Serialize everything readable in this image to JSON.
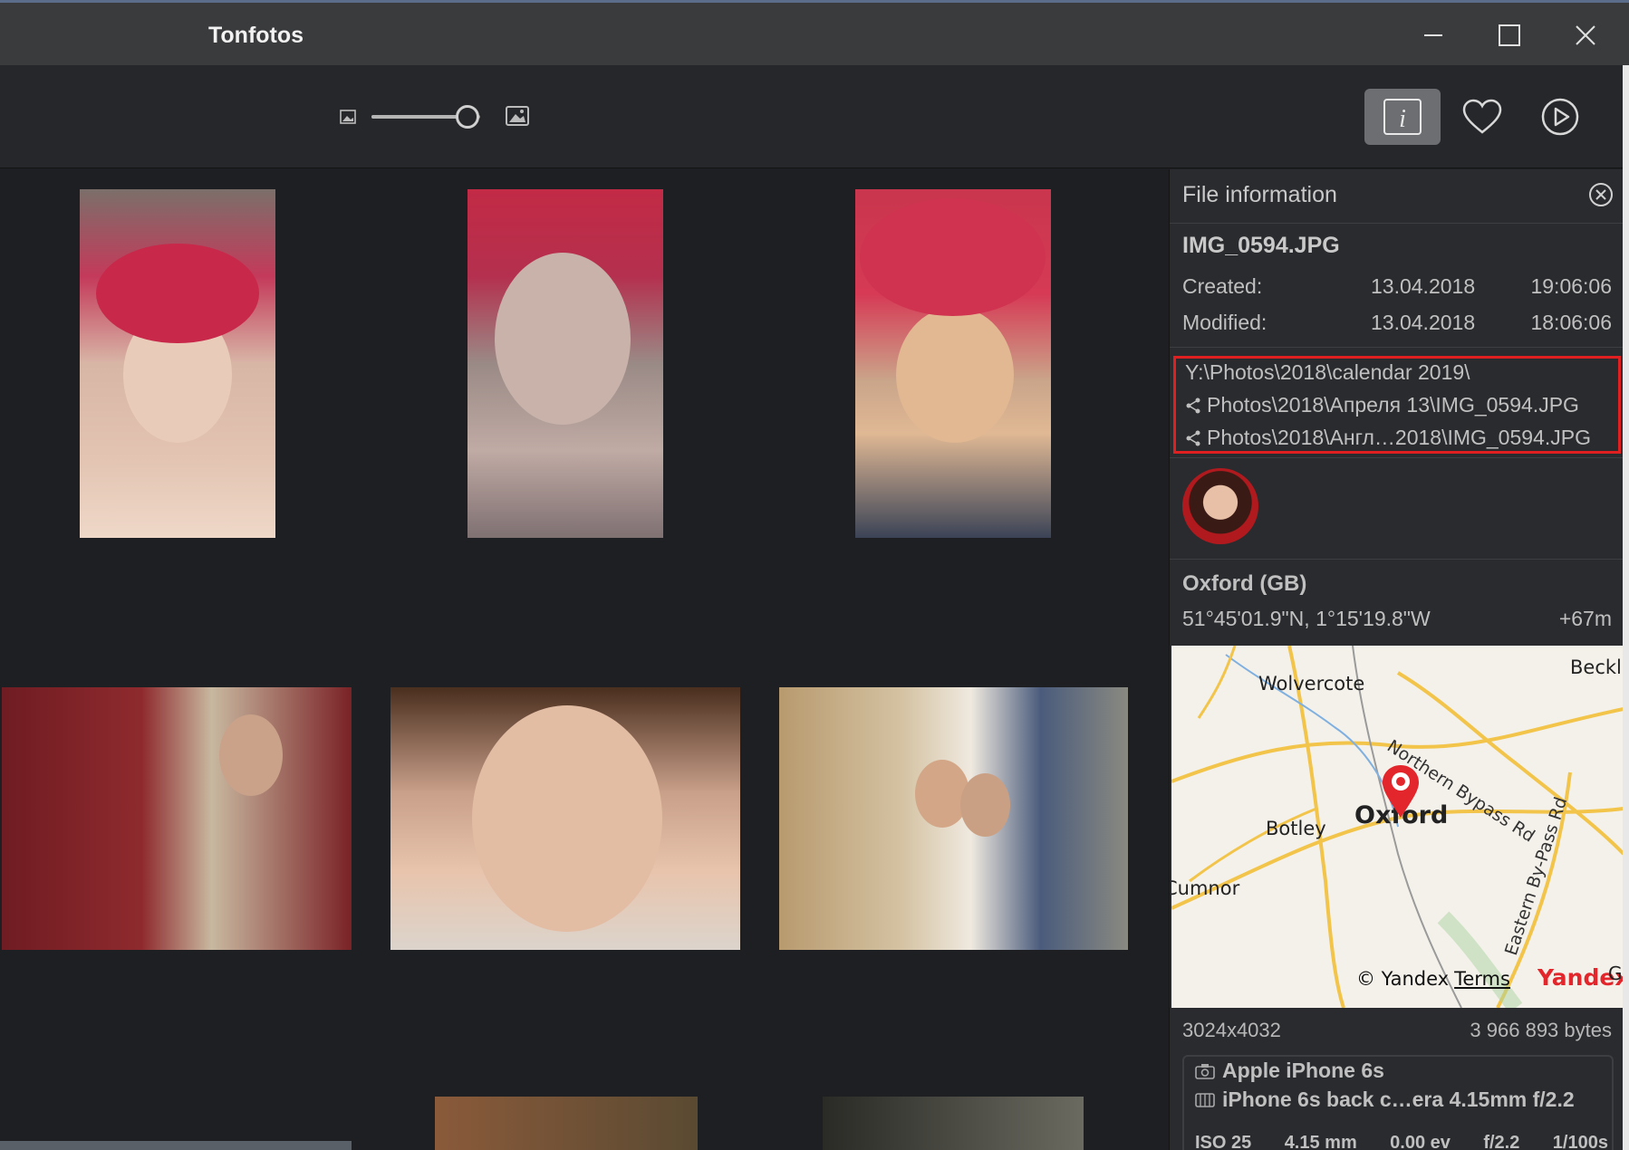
{
  "window": {
    "title": "Tonfotos",
    "minimize_icon": "minimize-icon",
    "maximize_icon": "maximize-icon",
    "close_icon": "close-icon"
  },
  "toolbar": {
    "zoom_small_icon": "image-small-icon",
    "zoom_large_icon": "image-large-icon",
    "thumbnail_size_level": 0.88,
    "buttons": [
      {
        "name": "info",
        "icon": "info-icon",
        "active": true
      },
      {
        "name": "favorite",
        "icon": "heart-icon",
        "active": false
      },
      {
        "name": "slideshow",
        "icon": "play-icon",
        "active": false
      }
    ]
  },
  "file_info": {
    "title": "File information",
    "file_name": "IMG_0594.JPG",
    "created_label": "Created:",
    "created_date": "13.04.2018",
    "created_time": "19:06:06",
    "modified_label": "Modified:",
    "modified_date": "13.04.2018",
    "modified_time": "18:06:06",
    "paths": [
      {
        "text": "Y:\\Photos\\2018\\calendar 2019\\",
        "linked": false
      },
      {
        "text": "Photos\\2018\\Апреля 13\\IMG_0594.JPG",
        "linked": true
      },
      {
        "text": "Photos\\2018\\Англ…2018\\IMG_0594.JPG",
        "linked": true
      }
    ],
    "location_name": "Oxford (GB)",
    "coordinates": "51°45'01.9\"N, 1°15'19.8\"W",
    "altitude": "+67m",
    "map": {
      "places": [
        "Wolvercote",
        "Beckl",
        "Botley",
        "Oxford",
        "Cumnor"
      ],
      "roads": [
        "Northern Bypass Rd",
        "Eastern By-Pass Rd"
      ],
      "copyright": "© Yandex",
      "terms": "Terms",
      "brand": "Yandex",
      "corner_text": "Ga"
    },
    "dimensions": "3024x4032",
    "size": "3 966 893 bytes",
    "camera": "Apple iPhone 6s",
    "lens": "iPhone 6s back c…era 4.15mm f/2.2",
    "exif": {
      "iso": "ISO 25",
      "focal": "4.15 mm",
      "ev": "0.00 ev",
      "aperture": "f/2.2",
      "shutter": "1/100s"
    }
  },
  "colors": {
    "accent_border": "#e02020",
    "map_pin": "#e3262b"
  }
}
